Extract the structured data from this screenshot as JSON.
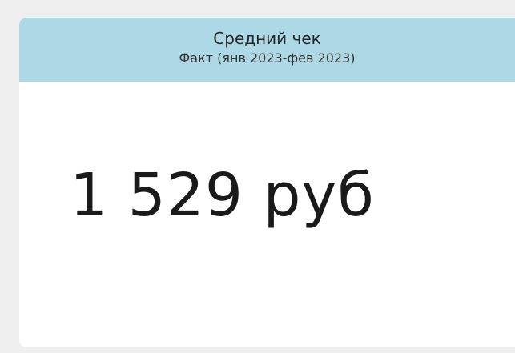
{
  "kpi_card": {
    "title": "Средний чек",
    "subtitle": "Факт (янв 2023-фев 2023)",
    "value": "1 529 руб"
  },
  "colors": {
    "header_background": "#add8e6",
    "page_background": "#efefef",
    "card_background": "#ffffff"
  }
}
